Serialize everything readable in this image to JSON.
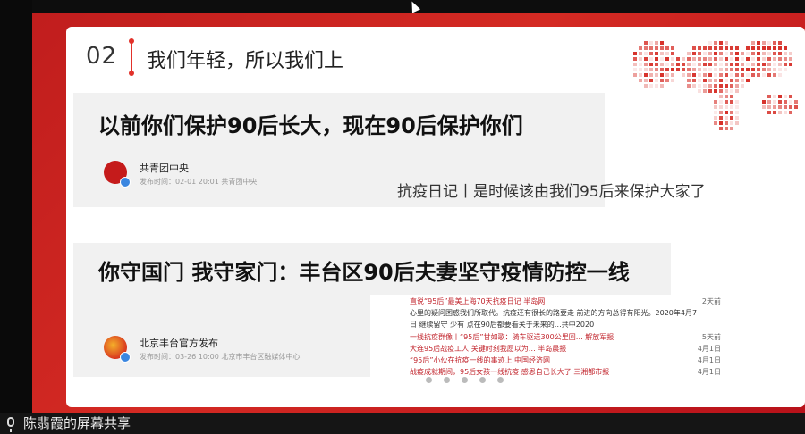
{
  "slide": {
    "number": "02",
    "title": "我们年轻，所以我们上"
  },
  "card1": {
    "headline": "以前你们保护90后长大，现在90后保护你们",
    "source": "共青团中央",
    "meta": "发布时间：02-01  20:01  共青团中央"
  },
  "side_text": "抗疫日记丨是时候该由我们95后来保护大家了",
  "card2": {
    "headline": "你守国门 我守家门：丰台区90后夫妻坚守疫情防控一线",
    "source": "北京丰台官方发布",
    "meta": "发布时间：03-26  10:00  北京市丰台区融媒体中心"
  },
  "news_list": [
    {
      "title": "直说“95后”最美上海70天抗疫日记   半岛网",
      "date": "2天前",
      "red": true
    },
    {
      "title": "心里的疑问困惑我们所取代。抗疫还有很长的路要走 前进的方向总得有阳光。2020年4月7",
      "date": "",
      "red": false
    },
    {
      "title": "日 继续留守 少有 点在90后都要看关于未来的…共中2020",
      "date": "",
      "red": false
    },
    {
      "title": "一线抗疫群像丨“95后”甘如歌：骑车驱送300公里回…   解放军报",
      "date": "5天前",
      "red": true
    },
    {
      "title": "大连95后战疫工人  关键时刻我愿以为…  半岛晨报",
      "date": "4月1日",
      "red": true
    },
    {
      "title": "“95后”小伙在抗疫一线的事迹上   中国经济网",
      "date": "4月1日",
      "red": true
    },
    {
      "title": "战疫成就期间，95后女孩一线抗疫 感恩自己长大了   三湘都市报",
      "date": "4月1日",
      "red": true
    }
  ],
  "screen_share": {
    "label": "陈翡霞的屏幕共享"
  },
  "colors": {
    "accent": "#e2312a",
    "background_red": "#c01d1d"
  }
}
